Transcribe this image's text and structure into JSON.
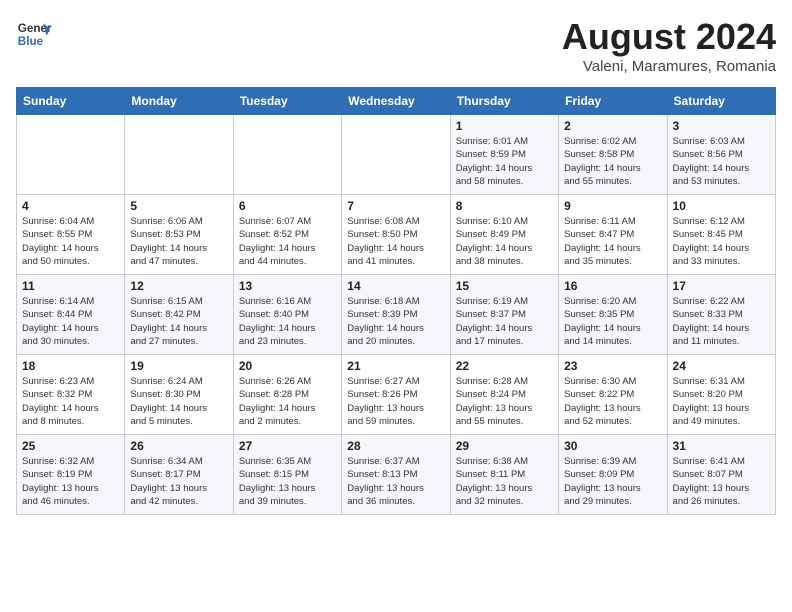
{
  "header": {
    "logo_line1": "General",
    "logo_line2": "Blue",
    "title": "August 2024",
    "subtitle": "Valeni, Maramures, Romania"
  },
  "weekdays": [
    "Sunday",
    "Monday",
    "Tuesday",
    "Wednesday",
    "Thursday",
    "Friday",
    "Saturday"
  ],
  "weeks": [
    [
      {
        "day": "",
        "info": ""
      },
      {
        "day": "",
        "info": ""
      },
      {
        "day": "",
        "info": ""
      },
      {
        "day": "",
        "info": ""
      },
      {
        "day": "1",
        "info": "Sunrise: 6:01 AM\nSunset: 8:59 PM\nDaylight: 14 hours\nand 58 minutes."
      },
      {
        "day": "2",
        "info": "Sunrise: 6:02 AM\nSunset: 8:58 PM\nDaylight: 14 hours\nand 55 minutes."
      },
      {
        "day": "3",
        "info": "Sunrise: 6:03 AM\nSunset: 8:56 PM\nDaylight: 14 hours\nand 53 minutes."
      }
    ],
    [
      {
        "day": "4",
        "info": "Sunrise: 6:04 AM\nSunset: 8:55 PM\nDaylight: 14 hours\nand 50 minutes."
      },
      {
        "day": "5",
        "info": "Sunrise: 6:06 AM\nSunset: 8:53 PM\nDaylight: 14 hours\nand 47 minutes."
      },
      {
        "day": "6",
        "info": "Sunrise: 6:07 AM\nSunset: 8:52 PM\nDaylight: 14 hours\nand 44 minutes."
      },
      {
        "day": "7",
        "info": "Sunrise: 6:08 AM\nSunset: 8:50 PM\nDaylight: 14 hours\nand 41 minutes."
      },
      {
        "day": "8",
        "info": "Sunrise: 6:10 AM\nSunset: 8:49 PM\nDaylight: 14 hours\nand 38 minutes."
      },
      {
        "day": "9",
        "info": "Sunrise: 6:11 AM\nSunset: 8:47 PM\nDaylight: 14 hours\nand 35 minutes."
      },
      {
        "day": "10",
        "info": "Sunrise: 6:12 AM\nSunset: 8:45 PM\nDaylight: 14 hours\nand 33 minutes."
      }
    ],
    [
      {
        "day": "11",
        "info": "Sunrise: 6:14 AM\nSunset: 8:44 PM\nDaylight: 14 hours\nand 30 minutes."
      },
      {
        "day": "12",
        "info": "Sunrise: 6:15 AM\nSunset: 8:42 PM\nDaylight: 14 hours\nand 27 minutes."
      },
      {
        "day": "13",
        "info": "Sunrise: 6:16 AM\nSunset: 8:40 PM\nDaylight: 14 hours\nand 23 minutes."
      },
      {
        "day": "14",
        "info": "Sunrise: 6:18 AM\nSunset: 8:39 PM\nDaylight: 14 hours\nand 20 minutes."
      },
      {
        "day": "15",
        "info": "Sunrise: 6:19 AM\nSunset: 8:37 PM\nDaylight: 14 hours\nand 17 minutes."
      },
      {
        "day": "16",
        "info": "Sunrise: 6:20 AM\nSunset: 8:35 PM\nDaylight: 14 hours\nand 14 minutes."
      },
      {
        "day": "17",
        "info": "Sunrise: 6:22 AM\nSunset: 8:33 PM\nDaylight: 14 hours\nand 11 minutes."
      }
    ],
    [
      {
        "day": "18",
        "info": "Sunrise: 6:23 AM\nSunset: 8:32 PM\nDaylight: 14 hours\nand 8 minutes."
      },
      {
        "day": "19",
        "info": "Sunrise: 6:24 AM\nSunset: 8:30 PM\nDaylight: 14 hours\nand 5 minutes."
      },
      {
        "day": "20",
        "info": "Sunrise: 6:26 AM\nSunset: 8:28 PM\nDaylight: 14 hours\nand 2 minutes."
      },
      {
        "day": "21",
        "info": "Sunrise: 6:27 AM\nSunset: 8:26 PM\nDaylight: 13 hours\nand 59 minutes."
      },
      {
        "day": "22",
        "info": "Sunrise: 6:28 AM\nSunset: 8:24 PM\nDaylight: 13 hours\nand 55 minutes."
      },
      {
        "day": "23",
        "info": "Sunrise: 6:30 AM\nSunset: 8:22 PM\nDaylight: 13 hours\nand 52 minutes."
      },
      {
        "day": "24",
        "info": "Sunrise: 6:31 AM\nSunset: 8:20 PM\nDaylight: 13 hours\nand 49 minutes."
      }
    ],
    [
      {
        "day": "25",
        "info": "Sunrise: 6:32 AM\nSunset: 8:19 PM\nDaylight: 13 hours\nand 46 minutes."
      },
      {
        "day": "26",
        "info": "Sunrise: 6:34 AM\nSunset: 8:17 PM\nDaylight: 13 hours\nand 42 minutes."
      },
      {
        "day": "27",
        "info": "Sunrise: 6:35 AM\nSunset: 8:15 PM\nDaylight: 13 hours\nand 39 minutes."
      },
      {
        "day": "28",
        "info": "Sunrise: 6:37 AM\nSunset: 8:13 PM\nDaylight: 13 hours\nand 36 minutes."
      },
      {
        "day": "29",
        "info": "Sunrise: 6:38 AM\nSunset: 8:11 PM\nDaylight: 13 hours\nand 32 minutes."
      },
      {
        "day": "30",
        "info": "Sunrise: 6:39 AM\nSunset: 8:09 PM\nDaylight: 13 hours\nand 29 minutes."
      },
      {
        "day": "31",
        "info": "Sunrise: 6:41 AM\nSunset: 8:07 PM\nDaylight: 13 hours\nand 26 minutes."
      }
    ]
  ]
}
